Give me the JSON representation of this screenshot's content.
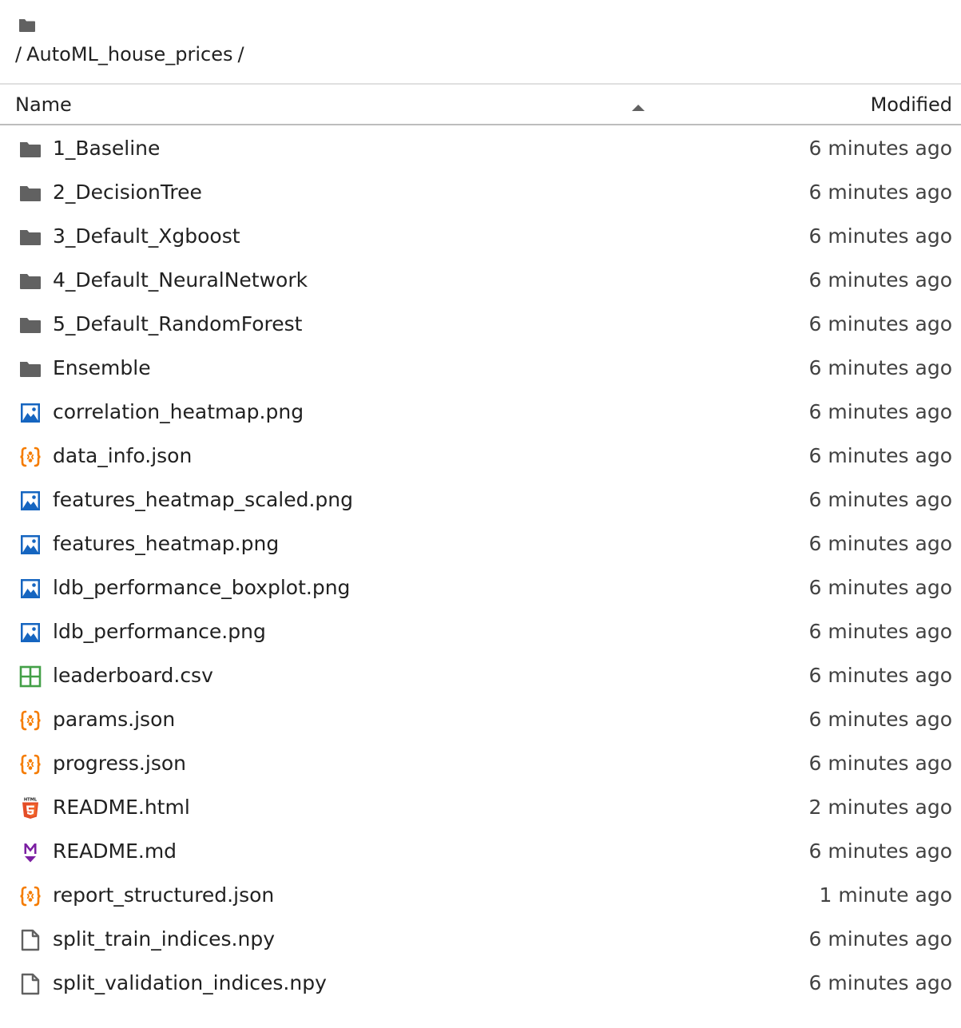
{
  "breadcrumb": {
    "root_icon": "folder-icon",
    "path_prefix": "/",
    "current_folder": "AutoML_house_prices",
    "path_suffix": "/"
  },
  "header": {
    "name_label": "Name",
    "modified_label": "Modified",
    "sort_direction": "ascending"
  },
  "colors": {
    "folder": "#616161",
    "image": "#1565c0",
    "json": "#f57c00",
    "csv": "#43a047",
    "html": "#e44d26",
    "markdown": "#7b1fa2",
    "generic": "#616161"
  },
  "files": [
    {
      "name": "1_Baseline",
      "modified": "6 minutes ago",
      "type": "folder",
      "icon": "folder-icon"
    },
    {
      "name": "2_DecisionTree",
      "modified": "6 minutes ago",
      "type": "folder",
      "icon": "folder-icon"
    },
    {
      "name": "3_Default_Xgboost",
      "modified": "6 minutes ago",
      "type": "folder",
      "icon": "folder-icon"
    },
    {
      "name": "4_Default_NeuralNetwork",
      "modified": "6 minutes ago",
      "type": "folder",
      "icon": "folder-icon"
    },
    {
      "name": "5_Default_RandomForest",
      "modified": "6 minutes ago",
      "type": "folder",
      "icon": "folder-icon"
    },
    {
      "name": "Ensemble",
      "modified": "6 minutes ago",
      "type": "folder",
      "icon": "folder-icon"
    },
    {
      "name": "correlation_heatmap.png",
      "modified": "6 minutes ago",
      "type": "image",
      "icon": "image-file-icon"
    },
    {
      "name": "data_info.json",
      "modified": "6 minutes ago",
      "type": "json",
      "icon": "json-file-icon"
    },
    {
      "name": "features_heatmap_scaled.png",
      "modified": "6 minutes ago",
      "type": "image",
      "icon": "image-file-icon"
    },
    {
      "name": "features_heatmap.png",
      "modified": "6 minutes ago",
      "type": "image",
      "icon": "image-file-icon"
    },
    {
      "name": "ldb_performance_boxplot.png",
      "modified": "6 minutes ago",
      "type": "image",
      "icon": "image-file-icon"
    },
    {
      "name": "ldb_performance.png",
      "modified": "6 minutes ago",
      "type": "image",
      "icon": "image-file-icon"
    },
    {
      "name": "leaderboard.csv",
      "modified": "6 minutes ago",
      "type": "csv",
      "icon": "spreadsheet-file-icon"
    },
    {
      "name": "params.json",
      "modified": "6 minutes ago",
      "type": "json",
      "icon": "json-file-icon"
    },
    {
      "name": "progress.json",
      "modified": "6 minutes ago",
      "type": "json",
      "icon": "json-file-icon"
    },
    {
      "name": "README.html",
      "modified": "2 minutes ago",
      "type": "html",
      "icon": "html5-file-icon",
      "icon_text": "HTML"
    },
    {
      "name": "README.md",
      "modified": "6 minutes ago",
      "type": "markdown",
      "icon": "markdown-file-icon"
    },
    {
      "name": "report_structured.json",
      "modified": "1 minute ago",
      "type": "json",
      "icon": "json-file-icon"
    },
    {
      "name": "split_train_indices.npy",
      "modified": "6 minutes ago",
      "type": "generic",
      "icon": "generic-file-icon"
    },
    {
      "name": "split_validation_indices.npy",
      "modified": "6 minutes ago",
      "type": "generic",
      "icon": "generic-file-icon"
    }
  ]
}
